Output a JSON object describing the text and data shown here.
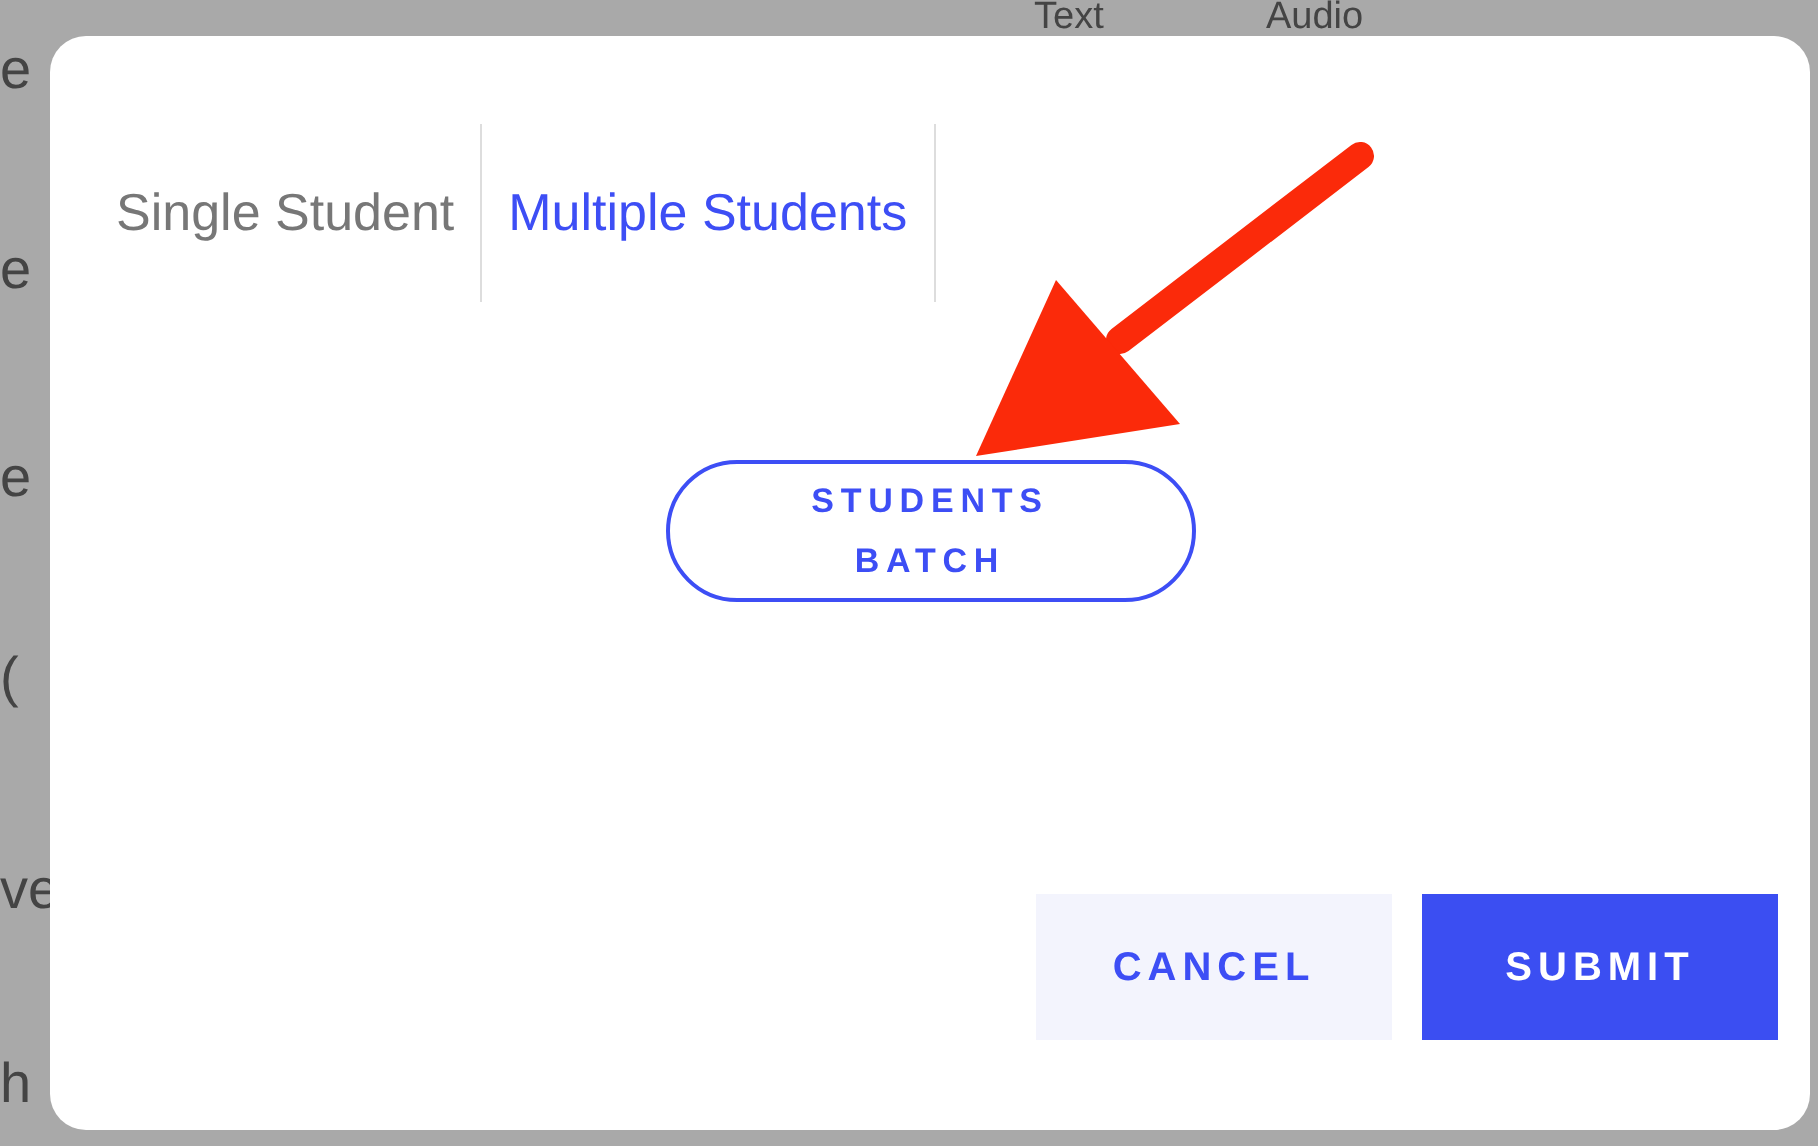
{
  "background": {
    "left_fragments": [
      "e",
      "e",
      "e",
      "(",
      "ve",
      "h"
    ],
    "column_headers": [
      "Text",
      "Audio"
    ]
  },
  "dialog": {
    "tabs": [
      {
        "label": "Single Student",
        "selected": false
      },
      {
        "label": "Multiple Students",
        "selected": true
      }
    ],
    "batch_button": {
      "label": "STUDENTS BATCH"
    },
    "buttons": [
      {
        "label": "CANCEL",
        "kind": "secondary"
      },
      {
        "label": "SUBMIT",
        "kind": "primary"
      }
    ]
  },
  "annotation": {
    "kind": "arrow"
  }
}
